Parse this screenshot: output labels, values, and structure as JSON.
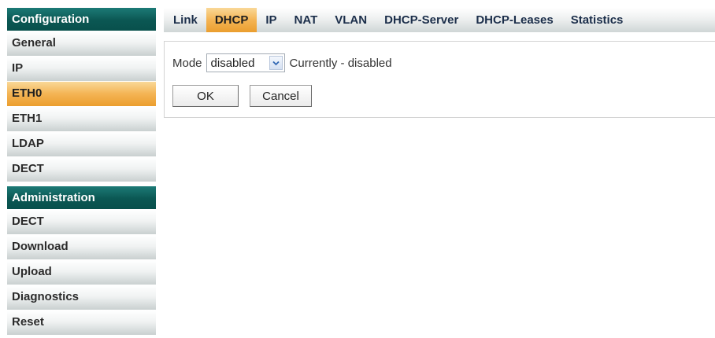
{
  "sidebar": {
    "configuration": {
      "header": "Configuration",
      "items": [
        {
          "label": "General"
        },
        {
          "label": "IP"
        },
        {
          "label": "ETH0"
        },
        {
          "label": "ETH1"
        },
        {
          "label": "LDAP"
        },
        {
          "label": "DECT"
        }
      ],
      "active": "ETH0"
    },
    "administration": {
      "header": "Administration",
      "items": [
        {
          "label": "DECT"
        },
        {
          "label": "Download"
        },
        {
          "label": "Upload"
        },
        {
          "label": "Diagnostics"
        },
        {
          "label": "Reset"
        }
      ]
    }
  },
  "tabs": [
    {
      "label": "Link"
    },
    {
      "label": "DHCP"
    },
    {
      "label": "IP"
    },
    {
      "label": "NAT"
    },
    {
      "label": "VLAN"
    },
    {
      "label": "DHCP-Server"
    },
    {
      "label": "DHCP-Leases"
    },
    {
      "label": "Statistics"
    }
  ],
  "active_tab": "DHCP",
  "form": {
    "mode_label": "Mode",
    "mode_value": "disabled",
    "status_text": "Currently - disabled",
    "ok_label": "OK",
    "cancel_label": "Cancel"
  },
  "colors": {
    "header": "#0b5753",
    "active": "#f4b454",
    "dropdown_arrow": "#2f66b3"
  },
  "icons": {
    "dropdown": "chevron-down-icon"
  }
}
